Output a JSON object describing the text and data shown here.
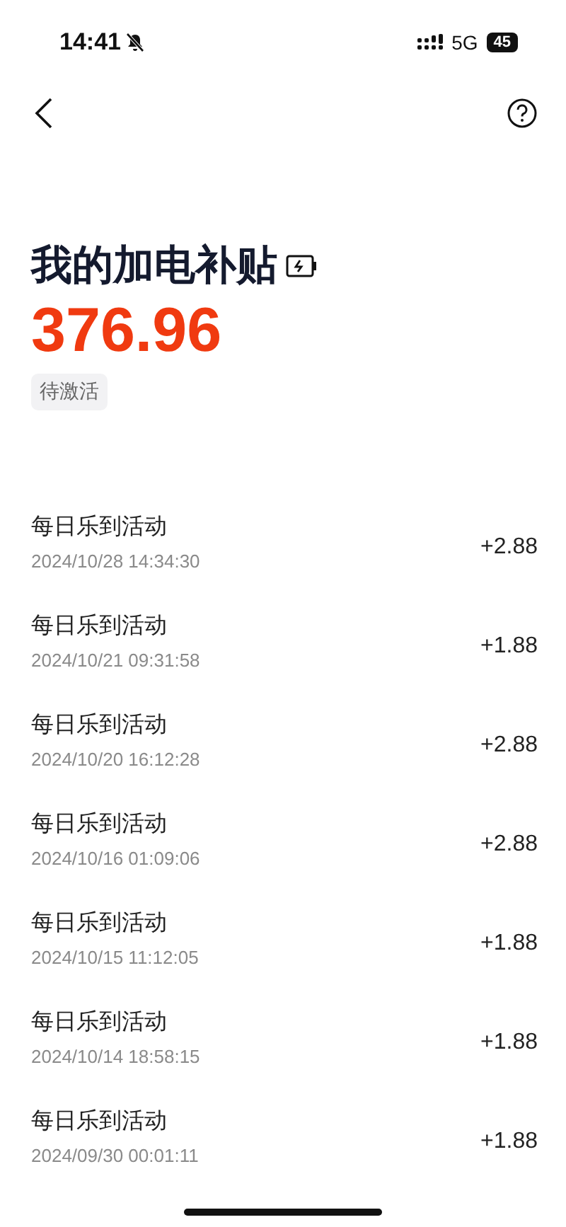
{
  "status_bar": {
    "time": "14:41",
    "network": "5G",
    "battery": "45"
  },
  "header": {
    "title": "我的加电补贴",
    "amount": "376.96",
    "status_tag": "待激活"
  },
  "records": [
    {
      "title": "每日乐到活动",
      "time": "2024/10/28 14:34:30",
      "amount": "+2.88"
    },
    {
      "title": "每日乐到活动",
      "time": "2024/10/21 09:31:58",
      "amount": "+1.88"
    },
    {
      "title": "每日乐到活动",
      "time": "2024/10/20 16:12:28",
      "amount": "+2.88"
    },
    {
      "title": "每日乐到活动",
      "time": "2024/10/16 01:09:06",
      "amount": "+2.88"
    },
    {
      "title": "每日乐到活动",
      "time": "2024/10/15 11:12:05",
      "amount": "+1.88"
    },
    {
      "title": "每日乐到活动",
      "time": "2024/10/14 18:58:15",
      "amount": "+1.88"
    },
    {
      "title": "每日乐到活动",
      "time": "2024/09/30 00:01:11",
      "amount": "+1.88"
    }
  ]
}
